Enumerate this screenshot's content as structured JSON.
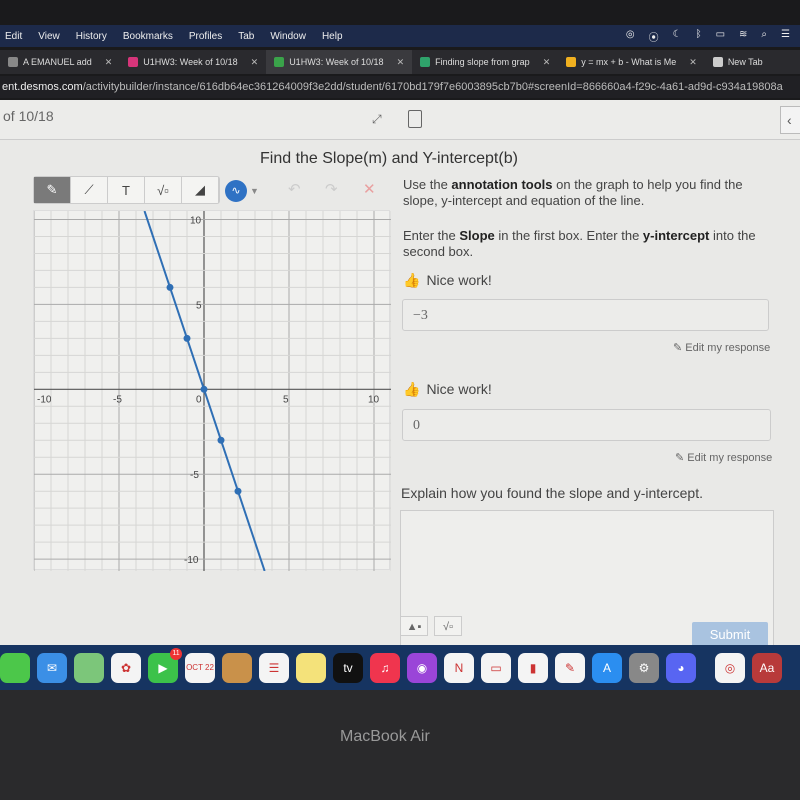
{
  "menubar": {
    "items": [
      "Edit",
      "View",
      "History",
      "Bookmarks",
      "Profiles",
      "Tab",
      "Window",
      "Help"
    ],
    "status_icons": [
      "creative-cloud-icon",
      "record-icon",
      "moon-icon",
      "bluetooth-icon",
      "battery-icon",
      "wifi-icon",
      "search-icon",
      "control-center-icon"
    ]
  },
  "tabs": [
    {
      "label": "A EMANUEL add",
      "active": false,
      "color": "#888888"
    },
    {
      "label": "U1HW3: Week of 10/18",
      "active": false,
      "color": "#d6357a"
    },
    {
      "label": "U1HW3: Week of 10/18",
      "active": true,
      "color": "#3aa34a"
    },
    {
      "label": "Finding slope from grap",
      "active": false,
      "color": "#2fa36b"
    },
    {
      "label": "y = mx + b - What is Me",
      "active": false,
      "color": "#f0b020"
    },
    {
      "label": "New Tab",
      "active": false,
      "color": "#cccccc"
    }
  ],
  "url": {
    "host": "ent.desmos.com",
    "path": "/activitybuilder/instance/616db64ec361264009f3e2dd/student/6170bd179f7e6003895cb7b0#screenId=866660a4-f29c-4a61-ad9d-c934a19808a"
  },
  "header": {
    "screen_label": "of 10/18",
    "expand_icon": "expand-icon",
    "calculator_icon": "calculator-icon",
    "collapse_icon": "‹"
  },
  "title": "Find the Slope(m) and Y-intercept(b)",
  "toolbar": {
    "tools": [
      {
        "name": "pencil",
        "glyph": "✎"
      },
      {
        "name": "line",
        "glyph": "⟋"
      },
      {
        "name": "text",
        "glyph": "T"
      },
      {
        "name": "math",
        "glyph": "√▫"
      },
      {
        "name": "eraser",
        "glyph": "◢"
      }
    ],
    "selected": "pencil",
    "color": "#2f72c4",
    "color_glyph": "∿",
    "undo": "↶",
    "redo": "↷",
    "clear": "✕"
  },
  "graph": {
    "x_ticks": [
      "-10",
      "-5",
      "0",
      "5",
      "10"
    ],
    "y_ticks": [
      "10",
      "5",
      "-5",
      "-10"
    ],
    "points": [
      [
        -2,
        6
      ],
      [
        -1,
        3
      ],
      [
        0,
        0
      ],
      [
        1,
        -3
      ],
      [
        2,
        -6
      ]
    ],
    "line": {
      "slope": -3,
      "intercept": 0,
      "color": "#2f6fb5"
    },
    "xlim": [
      -10,
      11
    ],
    "ylim": [
      -10.7,
      10.5
    ]
  },
  "instructions": {
    "p1_pre": "Use the ",
    "p1_bold": "annotation tools",
    "p1_post": " on the graph to help you find the slope, y-intercept and equation of the line.",
    "p2_pre": "Enter the ",
    "p2_bold1": "Slope",
    "p2_mid": " in the first box. Enter the ",
    "p2_bold2": "y-intercept",
    "p2_post": " into the second box."
  },
  "answers": [
    {
      "feedback": "Nice work!",
      "value": "−3",
      "edit": "Edit my response"
    },
    {
      "feedback": "Nice work!",
      "value": "0",
      "edit": "Edit my response"
    }
  ],
  "explain": {
    "prompt": "Explain how you found the slope and y-intercept.",
    "image_btn": "▲▪",
    "math_btn": "√▫",
    "submit": "Submit"
  },
  "dock": {
    "apps": [
      {
        "name": "messages",
        "bg": "#4cc74a",
        "label": ""
      },
      {
        "name": "mail",
        "bg": "#3b8fe6",
        "label": "✉"
      },
      {
        "name": "maps",
        "bg": "#7cc67a",
        "label": ""
      },
      {
        "name": "photos",
        "bg": "#f4f4f4",
        "label": "✿"
      },
      {
        "name": "facetime",
        "bg": "#3cc24a",
        "label": "▶",
        "badge": "11"
      },
      {
        "name": "calendar",
        "bg": "#f4f4f4",
        "label": "OCT 22"
      },
      {
        "name": "contacts",
        "bg": "#c9914a",
        "label": ""
      },
      {
        "name": "reminders",
        "bg": "#f4f4f4",
        "label": "☰"
      },
      {
        "name": "notes",
        "bg": "#f4e27a",
        "label": ""
      },
      {
        "name": "apple-tv",
        "bg": "#111111",
        "label": "tv"
      },
      {
        "name": "music",
        "bg": "#f0354e",
        "label": "♫"
      },
      {
        "name": "podcasts",
        "bg": "#9a45d8",
        "label": "◉"
      },
      {
        "name": "news",
        "bg": "#f4f4f4",
        "label": "N"
      },
      {
        "name": "keynote",
        "bg": "#f4f4f4",
        "label": "▭"
      },
      {
        "name": "numbers",
        "bg": "#f4f4f4",
        "label": "▮"
      },
      {
        "name": "pages",
        "bg": "#f4f4f4",
        "label": "✎"
      },
      {
        "name": "app-store",
        "bg": "#2b8ef0",
        "label": "A"
      },
      {
        "name": "system-preferences",
        "bg": "#888888",
        "label": "⚙"
      },
      {
        "name": "discord",
        "bg": "#5865f2",
        "label": "◕"
      },
      {
        "name": "chrome",
        "bg": "#f4f4f4",
        "label": "◎"
      },
      {
        "name": "dictionary",
        "bg": "#b83a3a",
        "label": "Aa"
      }
    ]
  },
  "device_label": "MacBook Air"
}
